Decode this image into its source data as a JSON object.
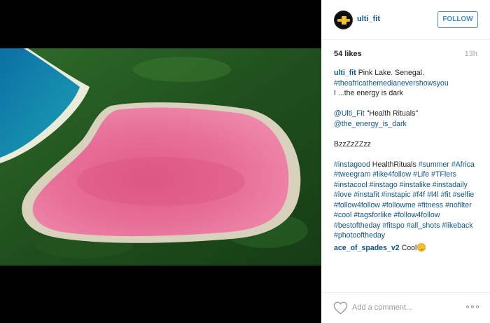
{
  "post": {
    "username": "ulti_fit",
    "follow_label": "FOLLOW",
    "likes": "54 likes",
    "time_ago": "13h",
    "caption": {
      "username": "ulti_fit",
      "line1": "Pink Lake. Senegal.",
      "line2": "#theafricathemedianevershowsyou",
      "line3": "I ...the energy is dark",
      "line4_mention": "@Ulti_Fit",
      "line4_text": "\"Health Rituals\"",
      "line5": "@the_energy_is_dark",
      "line6": "BzzZzZZzz",
      "tags": [
        [
          {
            "t": "#instagood",
            "tag": true
          },
          {
            "t": " HealthRituals ",
            "tag": false
          },
          {
            "t": "#summer",
            "tag": true
          },
          {
            "t": " ",
            "tag": false
          },
          {
            "t": "#Africa",
            "tag": true
          }
        ],
        [
          {
            "t": "#tweegram",
            "tag": true
          },
          {
            "t": " ",
            "tag": false
          },
          {
            "t": "#like4follow",
            "tag": true
          },
          {
            "t": " ",
            "tag": false
          },
          {
            "t": "#Life",
            "tag": true
          },
          {
            "t": " ",
            "tag": false
          },
          {
            "t": "#TFlers",
            "tag": true
          }
        ],
        [
          {
            "t": "#instacool",
            "tag": true
          },
          {
            "t": " ",
            "tag": false
          },
          {
            "t": "#instago",
            "tag": true
          },
          {
            "t": " ",
            "tag": false
          },
          {
            "t": "#instalike",
            "tag": true
          },
          {
            "t": " ",
            "tag": false
          },
          {
            "t": "#instadaily",
            "tag": true
          }
        ],
        [
          {
            "t": "#love",
            "tag": true
          },
          {
            "t": " ",
            "tag": false
          },
          {
            "t": "#instafit",
            "tag": true
          },
          {
            "t": " ",
            "tag": false
          },
          {
            "t": "#instapic",
            "tag": true
          },
          {
            "t": " ",
            "tag": false
          },
          {
            "t": "#f4f",
            "tag": true
          },
          {
            "t": " ",
            "tag": false
          },
          {
            "t": "#l4l",
            "tag": true
          },
          {
            "t": " ",
            "tag": false
          },
          {
            "t": "#fit",
            "tag": true
          },
          {
            "t": " ",
            "tag": false
          },
          {
            "t": "#selfie",
            "tag": true
          }
        ],
        [
          {
            "t": "#follow4follow",
            "tag": true
          },
          {
            "t": " ",
            "tag": false
          },
          {
            "t": "#followme",
            "tag": true
          },
          {
            "t": " ",
            "tag": false
          },
          {
            "t": "#fitness",
            "tag": true
          },
          {
            "t": " ",
            "tag": false
          },
          {
            "t": "#nofilter",
            "tag": true
          }
        ],
        [
          {
            "t": "#cool",
            "tag": true
          },
          {
            "t": " ",
            "tag": false
          },
          {
            "t": "#tagsforlike",
            "tag": true
          },
          {
            "t": " ",
            "tag": false
          },
          {
            "t": "#follow4follow",
            "tag": true
          }
        ],
        [
          {
            "t": "#bestoftheday",
            "tag": true
          },
          {
            "t": " ",
            "tag": false
          },
          {
            "t": "#fitspo",
            "tag": true
          },
          {
            "t": " ",
            "tag": false
          },
          {
            "t": "#all_shots",
            "tag": true
          },
          {
            "t": " ",
            "tag": false
          },
          {
            "t": "#likeback",
            "tag": true
          }
        ],
        [
          {
            "t": "#photooftheday",
            "tag": true
          }
        ]
      ]
    },
    "comments": [
      {
        "username": "ace_of_spades_v2",
        "text": "Cool",
        "emoji": "smiling-face-emoji"
      }
    ],
    "comment_placeholder": "Add a comment...",
    "icons": {
      "heart": "heart-icon",
      "more": "more-options-icon"
    },
    "colors": {
      "link": "#125688",
      "follow": "#3e8ed0",
      "lake": "#e56a94"
    }
  }
}
